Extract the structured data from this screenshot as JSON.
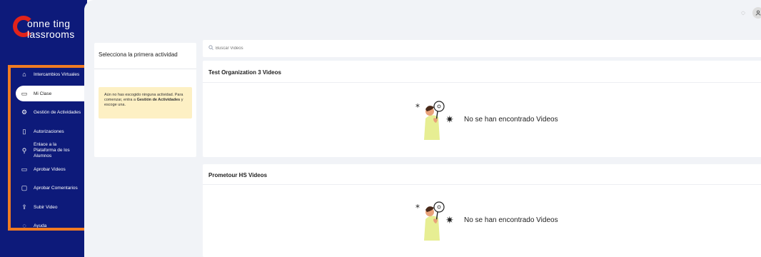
{
  "brand": {
    "line1": "onne ting",
    "line2": "lassrooms"
  },
  "sidebar": {
    "items": [
      {
        "label": "Intercambios Virtuales",
        "icon": "home-icon",
        "glyph": "⌂"
      },
      {
        "label": "Mi Clase",
        "icon": "video-icon",
        "glyph": "▭",
        "active": true
      },
      {
        "label": "Gestión de Actividades",
        "icon": "gear-icon",
        "glyph": "⚙"
      },
      {
        "label": "Autorizaciones",
        "icon": "document-icon",
        "glyph": "▯"
      },
      {
        "label": "Enlace a la Plataforma de los Alumnos",
        "icon": "link-icon",
        "glyph": "⚲"
      },
      {
        "label": "Aprobar Videos",
        "icon": "video-icon",
        "glyph": "▭"
      },
      {
        "label": "Aprobar Comentarios",
        "icon": "comment-icon",
        "glyph": "▢"
      },
      {
        "label": "Subir Video",
        "icon": "upload-icon",
        "glyph": "⇪"
      },
      {
        "label": "Ayuda",
        "icon": "help-icon",
        "glyph": "◌"
      }
    ]
  },
  "activity": {
    "title": "Selecciona la primera actividad",
    "note_part1": "Aún no has escogido ninguna actividad. Para comenzar, entra a ",
    "note_bold": "Gestión de Actividades",
    "note_part2": " y escoge una."
  },
  "search": {
    "placeholder": "Buscar Videos"
  },
  "video_sections": [
    {
      "title": "Test Organization 3 Videos",
      "empty_text": "No se han encontrado Videos"
    },
    {
      "title": "Prometour HS Videos",
      "empty_text": "No se han encontrado Videos"
    }
  ],
  "colors": {
    "sidebar": "#0d1a7a",
    "highlight": "#f07b22",
    "note_bg": "#fdf0c4",
    "background": "#f1f3f7"
  }
}
